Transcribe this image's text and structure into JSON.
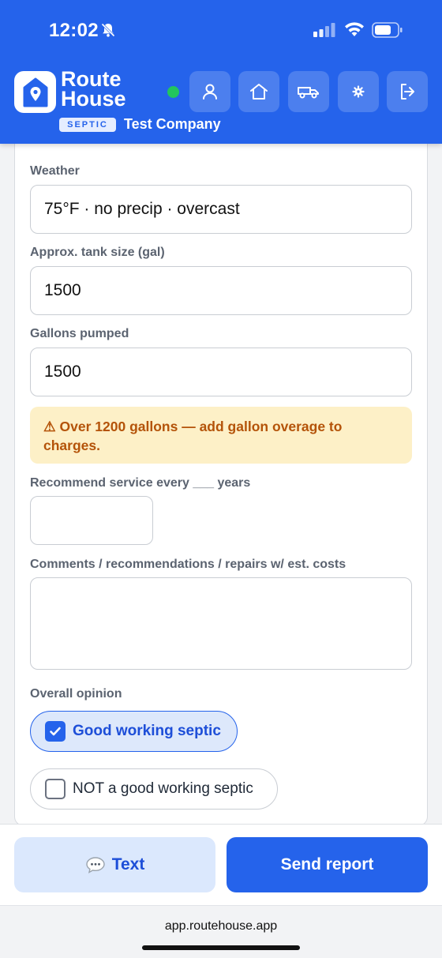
{
  "status_bar": {
    "time": "12:02"
  },
  "header": {
    "brand_line1": "Route",
    "brand_line2": "House",
    "badge": "SEPTIC",
    "company": "Test Company",
    "nav_icons": [
      "user-icon",
      "home-icon",
      "truck-icon",
      "gear-icon",
      "logout-icon"
    ],
    "accent_color": "#2563eb",
    "online_color": "#22c55e"
  },
  "form": {
    "weather": {
      "label": "Weather",
      "value": "75°F · no precip · overcast"
    },
    "tank_size": {
      "label": "Approx. tank size (gal)",
      "value": "1500"
    },
    "gallons_pumped": {
      "label": "Gallons pumped",
      "value": "1500"
    },
    "warning": "⚠ Over 1200 gallons — add gallon overage to charges.",
    "recommend": {
      "label": "Recommend service every ___ years",
      "value": ""
    },
    "comments": {
      "label": "Comments / recommendations / repairs w/ est. costs",
      "value": ""
    },
    "opinion": {
      "label": "Overall opinion",
      "options": [
        {
          "label": "Good working septic",
          "checked": true
        },
        {
          "label": "NOT a good working septic",
          "checked": false
        }
      ]
    }
  },
  "actions": {
    "text_label": "Text",
    "send_label": "Send report"
  },
  "browser": {
    "url": "app.routehouse.app"
  }
}
